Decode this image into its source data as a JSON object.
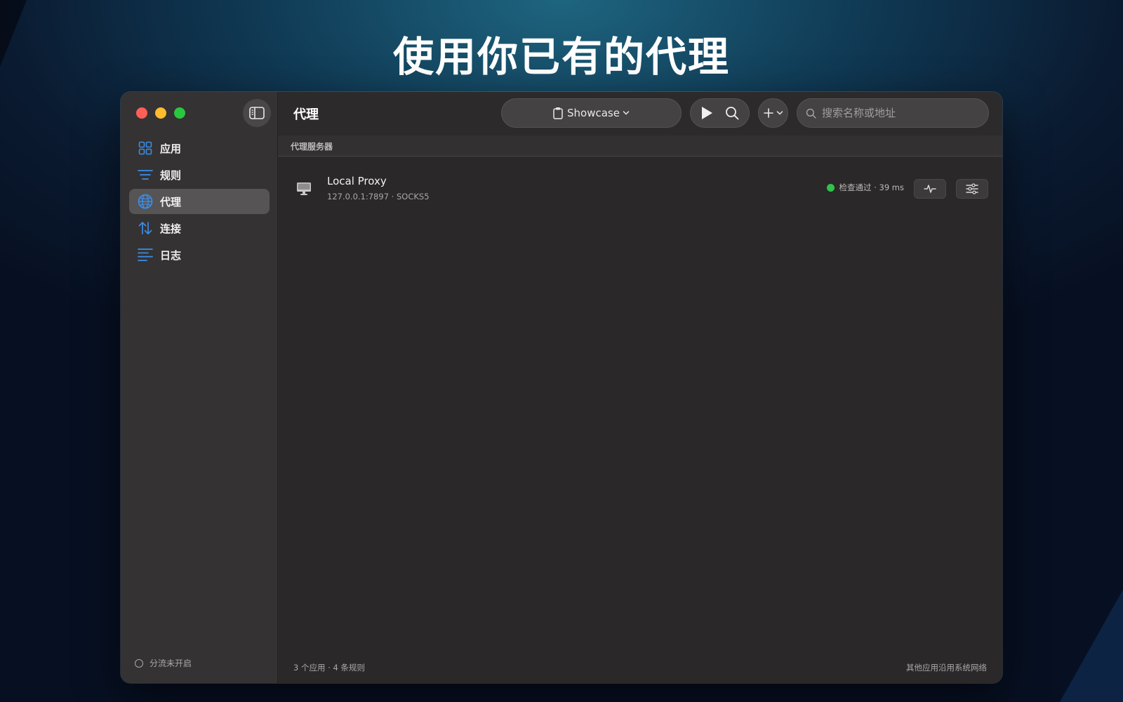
{
  "headline": "使用你已有的代理",
  "window": {
    "title": "代理",
    "sidebar": {
      "items": [
        {
          "label": "应用",
          "icon": "grid-icon",
          "active": false
        },
        {
          "label": "规则",
          "icon": "list-lines-icon",
          "active": false
        },
        {
          "label": "代理",
          "icon": "globe-icon",
          "active": true
        },
        {
          "label": "连接",
          "icon": "arrows-updown-icon",
          "active": false
        },
        {
          "label": "日志",
          "icon": "log-lines-icon",
          "active": false
        }
      ],
      "footer_status": "分流未开启"
    },
    "toolbar": {
      "profile_label": "Showcase",
      "search_placeholder": "搜索名称或地址"
    },
    "section_header": "代理服务器",
    "proxies": [
      {
        "name": "Local Proxy",
        "address": "127.0.0.1:7897 · SOCKS5",
        "status": "检查通过 · 39 ms",
        "status_color": "#30c24b"
      }
    ],
    "footer_left": "3 个应用 · 4 条规则",
    "footer_right": "其他应用沿用系统网络"
  },
  "colors": {
    "accent": "#3b8de8",
    "active_row": "#575455"
  }
}
